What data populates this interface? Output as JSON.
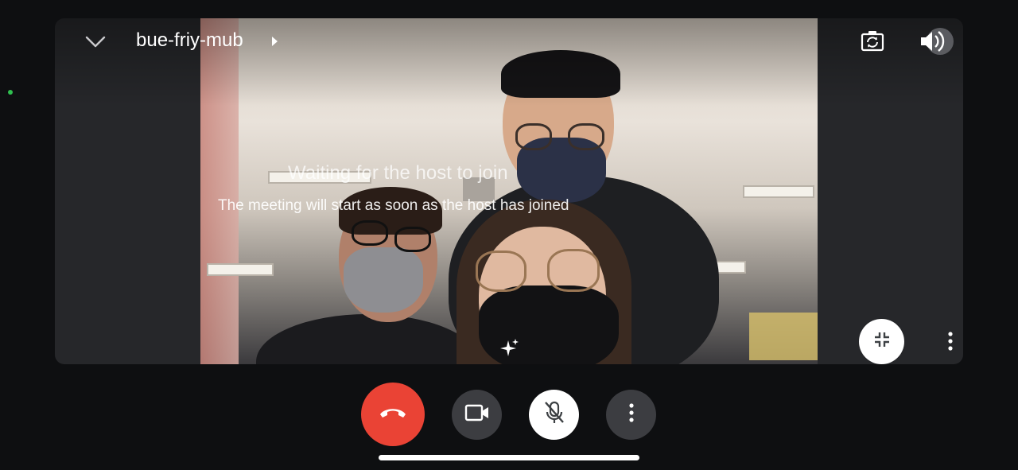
{
  "meeting": {
    "code": "bue-friy-mub"
  },
  "overlay": {
    "title": "Waiting for the host to join",
    "subtitle": "The meeting will start as soon as the host has joined"
  },
  "icons": {
    "collapse": "chevron-down-icon",
    "title_caret": "play-arrow-icon",
    "flip_camera": "flip-camera-icon",
    "speaker": "volume-icon",
    "shrink": "fullscreen-exit-icon",
    "tile_more": "more-vert-icon",
    "effects": "sparkle-icon",
    "end_call": "phone-hangup-icon",
    "camera": "videocam-icon",
    "mic": "mic-off-icon",
    "more": "more-vert-icon"
  },
  "colors": {
    "end_call": "#ea4335",
    "control_bg": "#3c3d41",
    "status_dot": "#2fbf4f"
  }
}
